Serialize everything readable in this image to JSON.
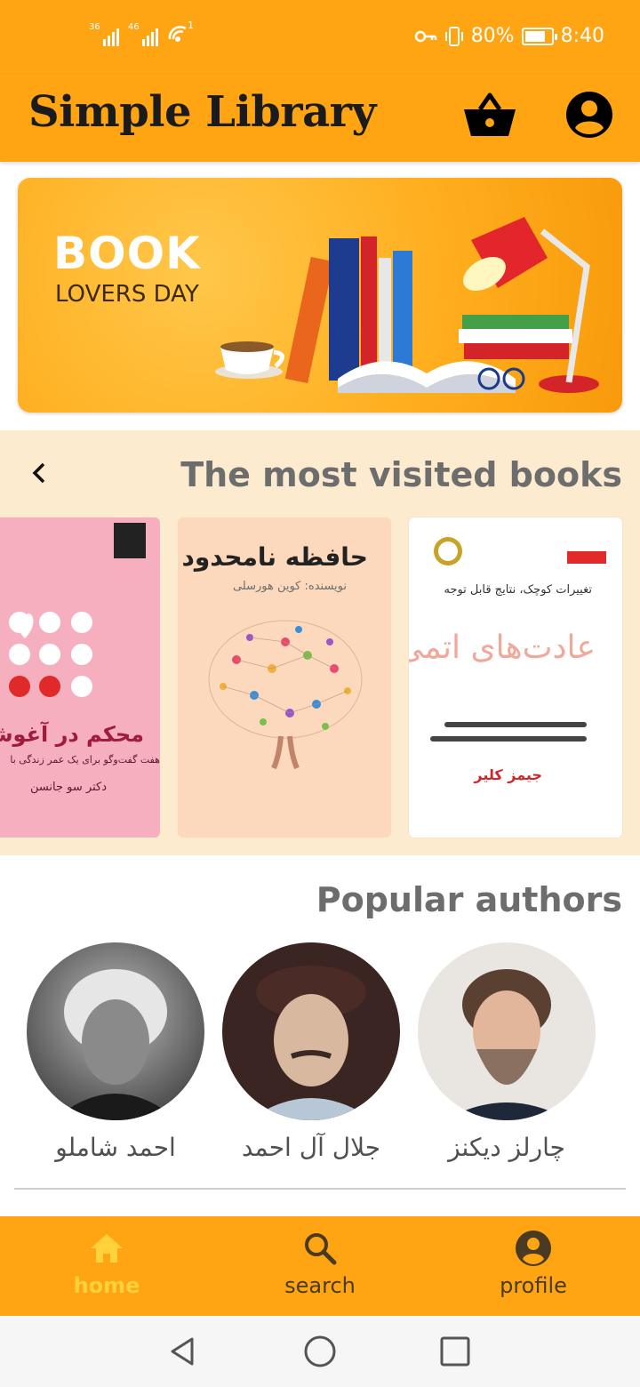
{
  "status_bar": {
    "sim1_label": "36",
    "sim2_label": "46",
    "hotspot_sup": "1",
    "battery_text": "80%",
    "battery_level": 0.8,
    "time": "8:40"
  },
  "app_bar": {
    "title": "Simple Library",
    "cart_icon": "basket-icon",
    "account_icon": "account-circle-icon"
  },
  "banner": {
    "headline": "BOOK",
    "subline": "LOVERS DAY"
  },
  "most_visited": {
    "title": "The most visited books",
    "books": [
      {
        "title": "عادت‌های اتمی",
        "author": "جیمز کلیر",
        "tagline": "تغییرات کوچک، نتایج قابل توجه"
      },
      {
        "title": "حافظه نامحدود",
        "author": "نویسنده: کوین هورسلی",
        "tagline": ""
      },
      {
        "title": "محکم در آغوشم",
        "author": "دکتر سو جانسن",
        "tagline": "هفت گفت‌وگو برای یک عمر زندگی با"
      }
    ]
  },
  "popular_authors": {
    "title": "Popular authors",
    "authors": [
      {
        "name": "احمد شاملو"
      },
      {
        "name": "جلال آل احمد"
      },
      {
        "name": "چارلز دیکنز"
      }
    ]
  },
  "bottom_nav": {
    "items": [
      {
        "label": "home",
        "icon": "home-icon",
        "active": true
      },
      {
        "label": "search",
        "icon": "search-icon",
        "active": false
      },
      {
        "label": "profile",
        "icon": "account-circle-icon",
        "active": false
      }
    ]
  },
  "colors": {
    "primary": "#FFA514",
    "section_bg": "#FDEBD0",
    "active_nav": "#FFD13A"
  }
}
